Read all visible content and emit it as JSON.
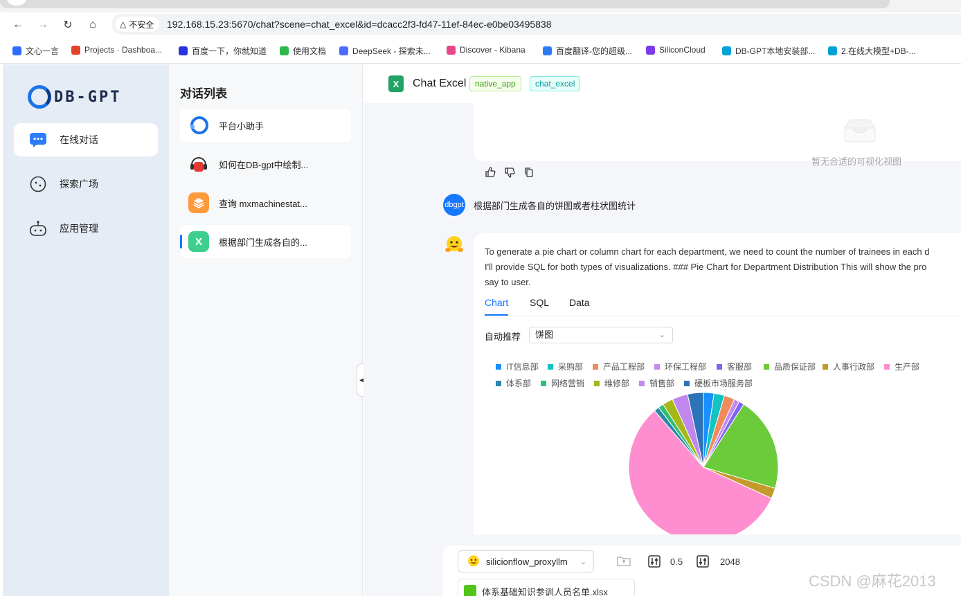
{
  "browser": {
    "insecure_label": "不安全",
    "url": "192.168.15.23:5670/chat?scene=chat_excel&id=dcacc2f3-fd47-11ef-84ec-e0be03495838",
    "bookmarks": [
      {
        "label": "文心一言",
        "color": "#2f6bff"
      },
      {
        "label": "Projects · Dashboa...",
        "color": "#e24329"
      },
      {
        "label": "百度一下，你就知道",
        "color": "#2932e1"
      },
      {
        "label": "使用文档",
        "color": "#2eb84b"
      },
      {
        "label": "DeepSeek - 探索未...",
        "color": "#4d6bfe"
      },
      {
        "label": "Discover - Kibana",
        "color": "#e8478b"
      },
      {
        "label": "百度翻译-您的超级...",
        "color": "#2b7bf6"
      },
      {
        "label": "SiliconCloud",
        "color": "#7c3aed"
      },
      {
        "label": "DB-GPT本地安装部...",
        "color": "#00a1d6"
      },
      {
        "label": "2.在线大模型+DB-...",
        "color": "#00a1d6"
      }
    ]
  },
  "leftnav": {
    "logo_text": "DB-GPT",
    "items": [
      {
        "label": "在线对话",
        "icon": "chat-bubble-icon"
      },
      {
        "label": "探索广场",
        "icon": "compass-icon"
      },
      {
        "label": "应用管理",
        "icon": "robot-icon"
      }
    ]
  },
  "convlist": {
    "title": "对话列表",
    "items": [
      {
        "label": "平台小助手",
        "icon": "dbgpt-logo-icon",
        "color": "#1a73e8"
      },
      {
        "label": "如何在DB-gpt中绘制...",
        "icon": "headset-icon",
        "color": "#e53935"
      },
      {
        "label": "查询 mxmachinestat...",
        "icon": "layers-icon",
        "color": "#ff8c1a"
      },
      {
        "label": "根据部门生成各自的...",
        "icon": "excel-icon",
        "color": "#3ecf8e"
      }
    ]
  },
  "header": {
    "title": "Chat Excel",
    "tags": [
      "native_app",
      "chat_excel"
    ]
  },
  "prev_card": {
    "empty_text": "暂无合适的可视化视图"
  },
  "user_msg": {
    "avatar_text": "dbgpt",
    "text": "根据部门生成各自的饼图或者柱状图统计"
  },
  "answer": {
    "lines": [
      "To generate a pie chart or column chart for each department, we need to count the number of trainees in each d",
      "I'll provide SQL for both types of visualizations. ### Pie Chart for Department Distribution This will show the pro",
      "say to user."
    ],
    "tabs": [
      "Chart",
      "SQL",
      "Data"
    ],
    "recommend_label": "自动推荐",
    "chart_type_value": "饼图"
  },
  "chart_data": {
    "type": "pie",
    "series": [
      {
        "name": "IT信息部",
        "value": 2,
        "color": "#1890ff"
      },
      {
        "name": "采购部",
        "value": 2,
        "color": "#13c2c2"
      },
      {
        "name": "产品工程部",
        "value": 2,
        "color": "#ef8a5a"
      },
      {
        "name": "环保工程部",
        "value": 1,
        "color": "#c78bf0"
      },
      {
        "name": "客服部",
        "value": 1,
        "color": "#7f66f0"
      },
      {
        "name": "品质保证部",
        "value": 18,
        "color": "#6ccb3a"
      },
      {
        "name": "人事行政部",
        "value": 2,
        "color": "#c59a2c"
      },
      {
        "name": "生产部",
        "value": 50,
        "color": "#ff8ed0"
      },
      {
        "name": "体系部",
        "value": 1,
        "color": "#2a8aa8"
      },
      {
        "name": "网络营销",
        "value": 1,
        "color": "#2fbf71"
      },
      {
        "name": "维修部",
        "value": 2,
        "color": "#a6b816"
      },
      {
        "name": "销售部",
        "value": 3,
        "color": "#c088ee"
      },
      {
        "name": "硬板市场服务部",
        "value": 3,
        "color": "#2d73b8"
      }
    ]
  },
  "input": {
    "model": "silicionflow_proxyllm",
    "temperature": "0.5",
    "max_tokens": "2048",
    "file_name": "体系基础知识参训人员名单.xlsx"
  },
  "watermark": "CSDN @麻花2013"
}
